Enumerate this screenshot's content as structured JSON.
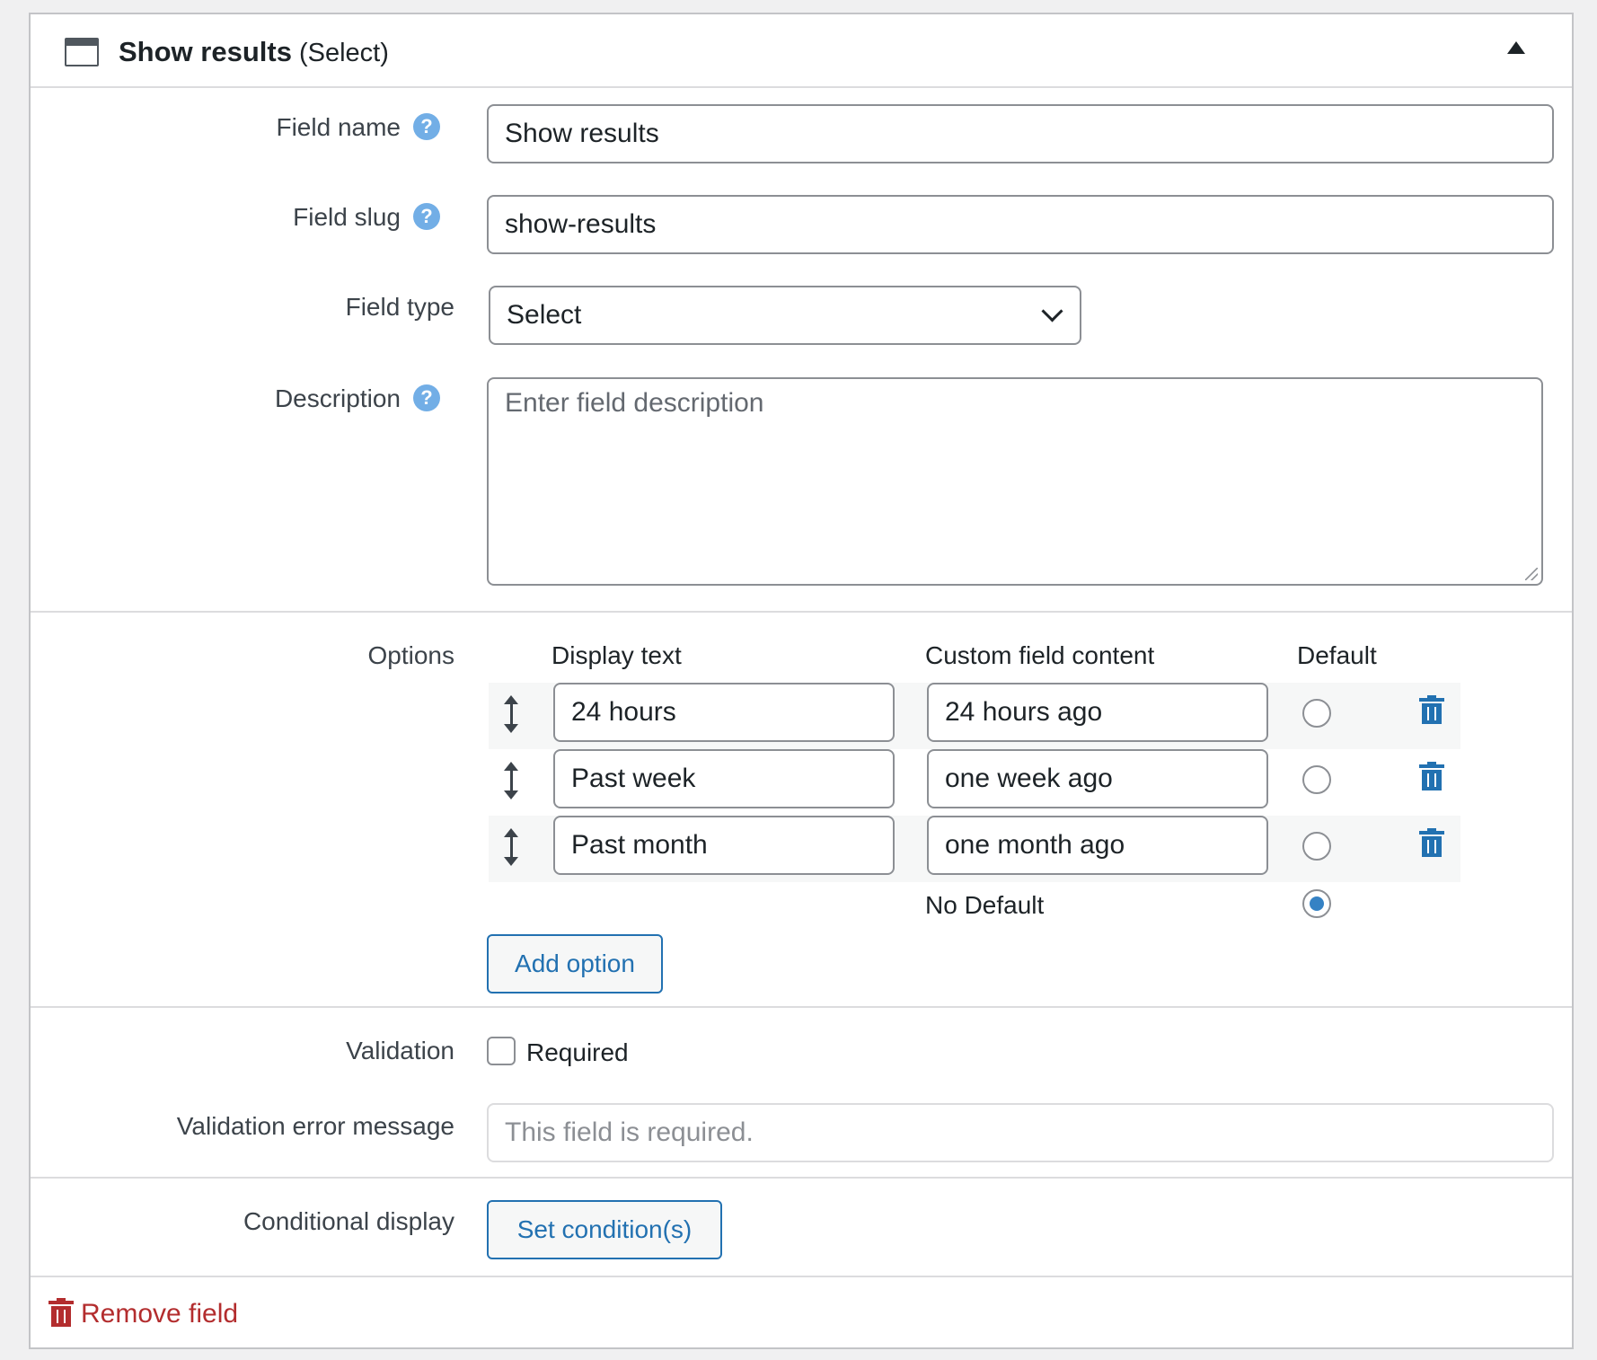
{
  "header": {
    "title": "Show results",
    "subtitle": "(Select)"
  },
  "fields": {
    "field_name_label": "Field name",
    "field_name_value": "Show results",
    "field_slug_label": "Field slug",
    "field_slug_value": "show-results",
    "field_type_label": "Field type",
    "field_type_value": "Select",
    "description_label": "Description",
    "description_placeholder": "Enter field description",
    "help_glyph": "?"
  },
  "options": {
    "label": "Options",
    "columns": {
      "display_text": "Display text",
      "custom_content": "Custom field content",
      "default": "Default"
    },
    "rows": [
      {
        "display": "24 hours",
        "content": "24 hours ago"
      },
      {
        "display": "Past week",
        "content": "one week ago"
      },
      {
        "display": "Past month",
        "content": "one month ago"
      }
    ],
    "no_default_label": "No Default",
    "add_option_label": "Add option"
  },
  "validation": {
    "label": "Validation",
    "required_label": "Required",
    "error_label": "Validation error message",
    "error_placeholder": "This field is required."
  },
  "conditional": {
    "label": "Conditional display",
    "button_label": "Set condition(s)"
  },
  "footer": {
    "remove_label": "Remove field"
  },
  "colors": {
    "accent": "#2271b1",
    "help": "#72aee6",
    "danger": "#b32d2e",
    "radio_selected": "#3582c4"
  }
}
